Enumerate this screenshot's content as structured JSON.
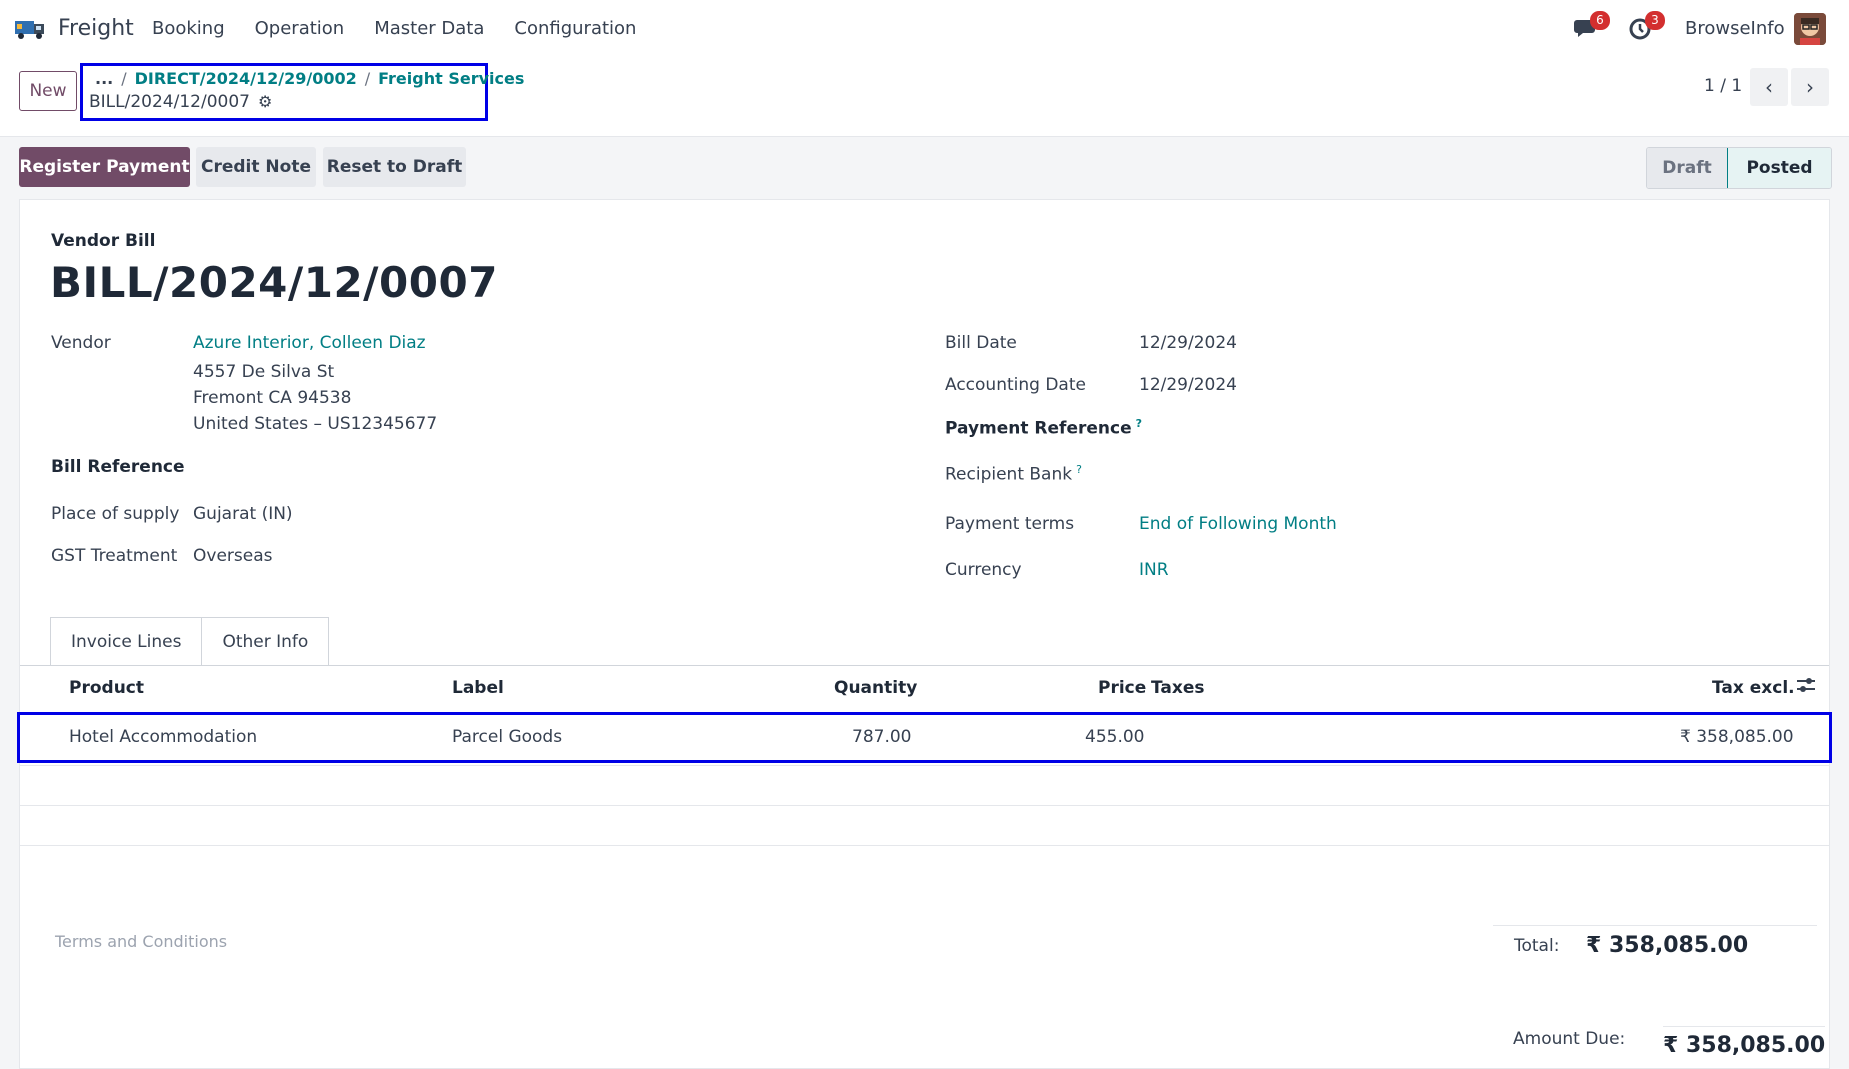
{
  "nav": {
    "app_name": "Freight",
    "menu": [
      "Booking",
      "Operation",
      "Master Data",
      "Configuration"
    ],
    "chat_count": "6",
    "activity_count": "3",
    "user": "BrowseInfo"
  },
  "control": {
    "new_label": "New",
    "breadcrumb_more": "...",
    "breadcrumb_parent": "DIRECT/2024/12/29/0002",
    "breadcrumb_section": "Freight Services",
    "breadcrumb_current": "BILL/2024/12/0007",
    "pager": "1 / 1"
  },
  "actions": {
    "register_payment": "Register Payment",
    "credit_note": "Credit Note",
    "reset_to_draft": "Reset to Draft",
    "status_draft": "Draft",
    "status_posted": "Posted"
  },
  "form": {
    "doc_type": "Vendor Bill",
    "title": "BILL/2024/12/0007",
    "vendor_label": "Vendor",
    "vendor_name": "Azure Interior, Colleen Diaz",
    "vendor_addr1": "4557 De Silva St",
    "vendor_addr2": "Fremont CA 94538",
    "vendor_addr3": "United States – US12345677",
    "bill_reference_label": "Bill Reference",
    "place_of_supply_label": "Place of supply",
    "place_of_supply": "Gujarat (IN)",
    "gst_treatment_label": "GST Treatment",
    "gst_treatment": "Overseas",
    "bill_date_label": "Bill Date",
    "bill_date": "12/29/2024",
    "accounting_date_label": "Accounting Date",
    "accounting_date": "12/29/2024",
    "payment_reference_label": "Payment Reference",
    "recipient_bank_label": "Recipient Bank",
    "payment_terms_label": "Payment terms",
    "payment_terms": "End of Following Month",
    "currency_label": "Currency",
    "currency": "INR",
    "help_mark": "?"
  },
  "tabs": [
    "Invoice Lines",
    "Other Info"
  ],
  "lines": {
    "headers": {
      "product": "Product",
      "label": "Label",
      "quantity": "Quantity",
      "price": "Price",
      "taxes": "Taxes",
      "tax_excl": "Tax excl."
    },
    "rows": [
      {
        "product": "Hotel Accommodation",
        "label": "Parcel Goods",
        "quantity": "787.00",
        "price": "455.00",
        "taxes": "",
        "tax_excl": "₹ 358,085.00"
      }
    ]
  },
  "footer": {
    "terms_placeholder": "Terms and Conditions",
    "total_label": "Total:",
    "total_value": "₹ 358,085.00",
    "amount_due_label": "Amount Due:",
    "amount_due_value": "₹ 358,085.00"
  },
  "colors": {
    "primary": "#714b67",
    "link": "#017e84",
    "highlight_box": "#0000e6",
    "badge": "#d32f2f"
  }
}
